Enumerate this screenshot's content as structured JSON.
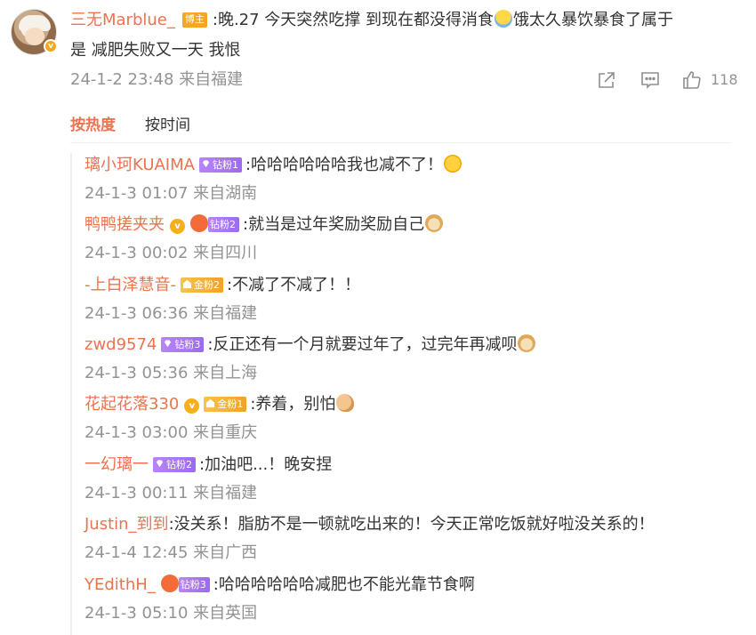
{
  "post": {
    "author": "三无Marblue_",
    "role_badge": "博主",
    "text_line1_a": ":晚.27 今天突然吃撑 到现在都没得消食",
    "text_line1_b": "饿太久暴饮暴食了属于",
    "text_line2": "是 减肥失败又一天 我恨",
    "time_location": "24-1-2 23:48 来自福建",
    "like_count": "118",
    "icons": [
      "share-icon",
      "comment-icon",
      "like-icon"
    ]
  },
  "tabs": [
    {
      "label": "按热度",
      "active": true
    },
    {
      "label": "按时间",
      "active": false
    }
  ],
  "replies": [
    {
      "name": "璃小珂KUAIMA",
      "verified": false,
      "fan_crown": false,
      "fan_type": "diamond",
      "fan_label": "钻粉1",
      "text": ":哈哈哈哈哈哈我也减不了！",
      "emoji": "cry-icon",
      "meta": "24-1-3 01:07 来自湖南"
    },
    {
      "name": "鸭鸭搓夹夹",
      "verified": true,
      "fan_crown": true,
      "fan_type": "diamond",
      "fan_label": "钻粉2",
      "text": ":就当是过年奖励奖励自己",
      "emoji": "doge-icon",
      "meta": "24-1-3 00:02 来自四川"
    },
    {
      "name": "-上白泽慧音-",
      "verified": false,
      "fan_crown": false,
      "fan_type": "gold",
      "fan_label": "金粉2",
      "text": ":不减了不减了！！",
      "emoji": "",
      "meta": "24-1-3 06:36 来自福建"
    },
    {
      "name": "zwd9574",
      "verified": false,
      "fan_crown": false,
      "fan_type": "diamond",
      "fan_label": "钻粉3",
      "text": ":反正还有一个月就要过年了，过完年再减呗",
      "emoji": "doge-icon",
      "meta": "24-1-3 05:36 来自上海"
    },
    {
      "name": "花起花落330",
      "verified": true,
      "fan_crown": false,
      "fan_type": "gold",
      "fan_label": "金粉1",
      "text": ":养着，别怕",
      "emoji": "muscle-icon",
      "meta": "24-1-3 03:00 来自重庆"
    },
    {
      "name": "一幻璃一",
      "verified": false,
      "fan_crown": false,
      "fan_type": "diamond",
      "fan_label": "钻粉2",
      "text": ":加油吧...！晚安捏",
      "emoji": "",
      "meta": "24-1-3 00:11 来自福建"
    },
    {
      "name": "Justin_到到",
      "verified": false,
      "fan_crown": false,
      "fan_type": "",
      "fan_label": "",
      "text": ":没关系！脂肪不是一顿就吃出来的！今天正常吃饭就好啦没关系的！",
      "emoji": "",
      "meta": "24-1-4 12:45 来自广西"
    },
    {
      "name": "YEdithH_",
      "verified": false,
      "fan_crown": true,
      "fan_type": "diamond",
      "fan_label": "钻粉3",
      "text": ":哈哈哈哈哈哈减肥也不能光靠节食啊",
      "emoji": "",
      "meta": "24-1-3 05:10 来自英国"
    }
  ],
  "colors": {
    "accent": "#eb7350",
    "meta": "#939393",
    "diamond_fan": "#a675f5",
    "gold_fan": "#f5a623"
  }
}
